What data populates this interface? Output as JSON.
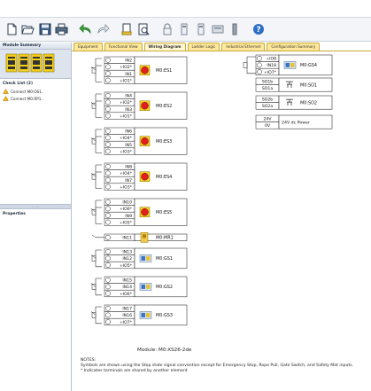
{
  "toolbar": {
    "buttons": [
      "new-icon",
      "open-icon",
      "save-icon",
      "print-icon",
      "undo-icon",
      "redo-icon",
      "report-icon",
      "preview-icon",
      "lock-icon",
      "module-left-icon",
      "module-right-icon",
      "drive-icon",
      "power-icon",
      "help-icon"
    ]
  },
  "left": {
    "module_summary": "Module Summary",
    "check_list_title": "Check List (2)",
    "check_items": [
      "Connect M0:OS1..",
      "Connect M0:RP1.."
    ],
    "properties": "Properties"
  },
  "tabs": [
    "Equipment",
    "Functional View",
    "Wiring Diagram",
    "Ladder Logic",
    "Industrial Ethernet",
    "Configuration Summary"
  ],
  "active_tab": "Wiring Diagram",
  "diagram": {
    "left_blocks": [
      {
        "terminals": [
          "IN2",
          "+IO2*",
          "IN1",
          "+IO1*"
        ],
        "device": "M0:ES1",
        "type": "estop"
      },
      {
        "terminals": [
          "IN4",
          "+IO2*",
          "IN3",
          "+IO1*"
        ],
        "device": "M0:ES2",
        "type": "estop"
      },
      {
        "terminals": [
          "IN6",
          "+IO4*",
          "IN5",
          "+IO3*"
        ],
        "device": "M0:ES3",
        "type": "estop"
      },
      {
        "terminals": [
          "IN8",
          "+IO4*",
          "IN7",
          "+IO3*"
        ],
        "device": "M0:ES4",
        "type": "estop"
      },
      {
        "terminals": [
          "IN10",
          "+IO6*",
          "IN9",
          "+IO5*"
        ],
        "device": "M0:ES5",
        "type": "estop"
      },
      {
        "terminals": [
          "IN11"
        ],
        "device": "M0:MR1",
        "type": "reset"
      },
      {
        "terminals": [
          "IN13",
          "IN12",
          "+IO5*"
        ],
        "device": "M0:GS1",
        "type": "gate"
      },
      {
        "terminals": [
          "IN15",
          "IN14",
          "+IO6*"
        ],
        "device": "M0:GS2",
        "type": "gate"
      },
      {
        "terminals": [
          "IN17",
          "IN16",
          "+IO7*"
        ],
        "device": "M0:GS3",
        "type": "gate"
      }
    ],
    "right_blocks": [
      {
        "terminals": [
          "+IO8",
          "IN18",
          "+IO7*"
        ],
        "device": "M0:GS4",
        "type": "gate"
      },
      {
        "terminals": [
          "SO1b",
          "SO1a"
        ],
        "device": "M0:SO1",
        "type": "output"
      },
      {
        "terminals": [
          "SO2b",
          "SO2a"
        ],
        "device": "M0:SO2",
        "type": "output"
      },
      {
        "terminals": [
          "24V",
          "0V"
        ],
        "device": "24V dc Power",
        "type": "power"
      }
    ]
  },
  "module_label": "Module:  M0:XS26-2de",
  "notes": {
    "title": "NOTES:",
    "line1": "Symbols are shown using the Stop state signal convention except for Emergency Stop, Rope Pull, Gate Switch, and Safety Mat inputs.",
    "line2": "* Indicates terminals are shared by another element"
  }
}
